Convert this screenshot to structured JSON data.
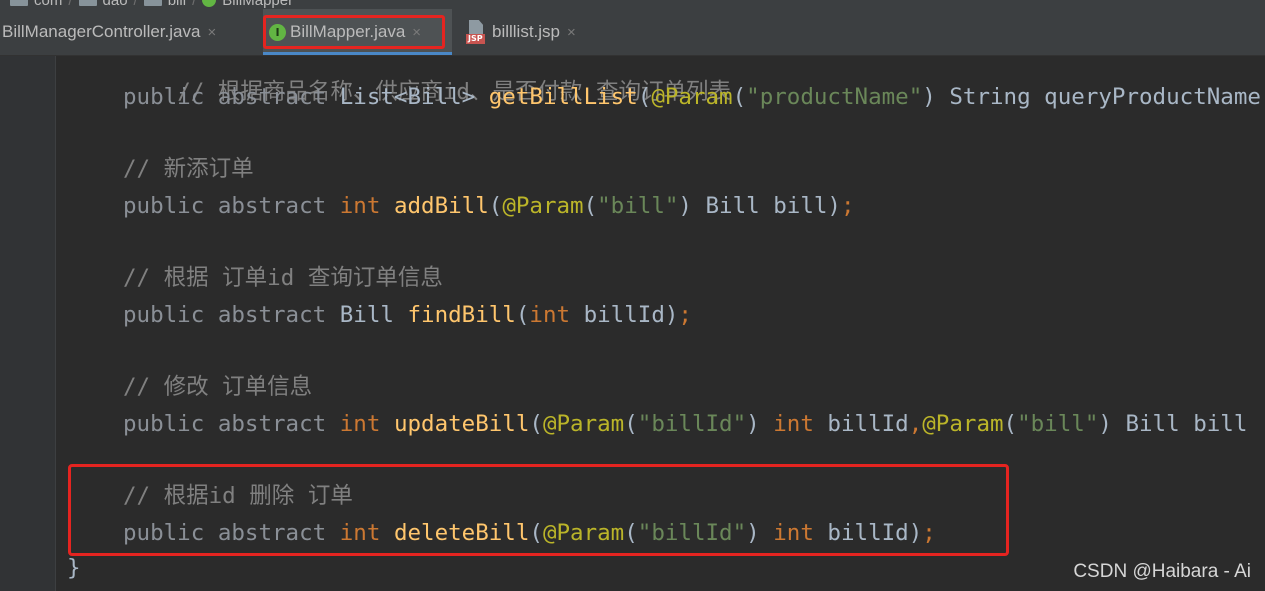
{
  "breadcrumb": {
    "items": [
      "com",
      "dao",
      "bill",
      "BillMapper"
    ]
  },
  "tabs": [
    {
      "label": "BillManagerController.java",
      "icon": "java-class-icon",
      "active": false
    },
    {
      "label": "BillMapper.java",
      "icon": "interface-icon",
      "icon_glyph": "I",
      "active": true
    },
    {
      "label": "billlist.jsp",
      "icon": "jsp-file-icon",
      "icon_tag": "JSP",
      "active": false
    }
  ],
  "close_glyph": "×",
  "code": {
    "line0": {
      "comment": "// 根据商品名称、供应商id、是否付款 查询订单列表"
    },
    "line1": {
      "modifiers": "public abstract",
      "ret": "List<Bill>",
      "name": "getBillList",
      "open": "(",
      "ann": "@Param",
      "ap": "(",
      "str": "\"productName\"",
      "cp": ")",
      "rest": " String queryProductName"
    },
    "line2": {
      "comment": "// 新添订单"
    },
    "line3": {
      "modifiers": "public abstract",
      "ret": "int",
      "name": "addBill",
      "open": "(",
      "ann": "@Param",
      "ap": "(",
      "str": "\"bill\"",
      "cp": ")",
      "rest": " Bill bill)",
      "semi": ";"
    },
    "line4": {
      "comment": "// 根据 订单id 查询订单信息"
    },
    "line5": {
      "modifiers": "public abstract",
      "ret": "Bill",
      "name": "findBill",
      "open": "(",
      "type": "int",
      "rest": " billId)",
      "semi": ";"
    },
    "line6": {
      "comment": "// 修改 订单信息"
    },
    "line7": {
      "modifiers": "public abstract",
      "ret": "int",
      "name": "updateBill",
      "open": "(",
      "ann": "@Param",
      "ap": "(",
      "str": "\"billId\"",
      "cp": ")",
      "type": "int",
      "arg": " billId",
      "comma": ",",
      "ann2": "@Param",
      "ap2": "(",
      "str2": "\"bill\"",
      "cp2": ")",
      "rest": " Bill bill"
    },
    "line8": {
      "comment": "// 根据id 删除 订单"
    },
    "line9": {
      "modifiers": "public abstract",
      "ret": "int",
      "name": "deleteBill",
      "open": "(",
      "ann": "@Param",
      "ap": "(",
      "str": "\"billId\"",
      "cp": ")",
      "type": "int",
      "rest": " billId)",
      "semi": ";"
    },
    "closing_brace": "}"
  },
  "watermark": "CSDN @Haibara - Ai",
  "colors": {
    "background": "#2b2b2b",
    "keyword": "#cc7832",
    "function": "#ffc66d",
    "annotation": "#bbb529",
    "string": "#6a8759",
    "comment": "#808080",
    "highlight_box": "#e52420",
    "active_tab_underline": "#4a88c7"
  }
}
